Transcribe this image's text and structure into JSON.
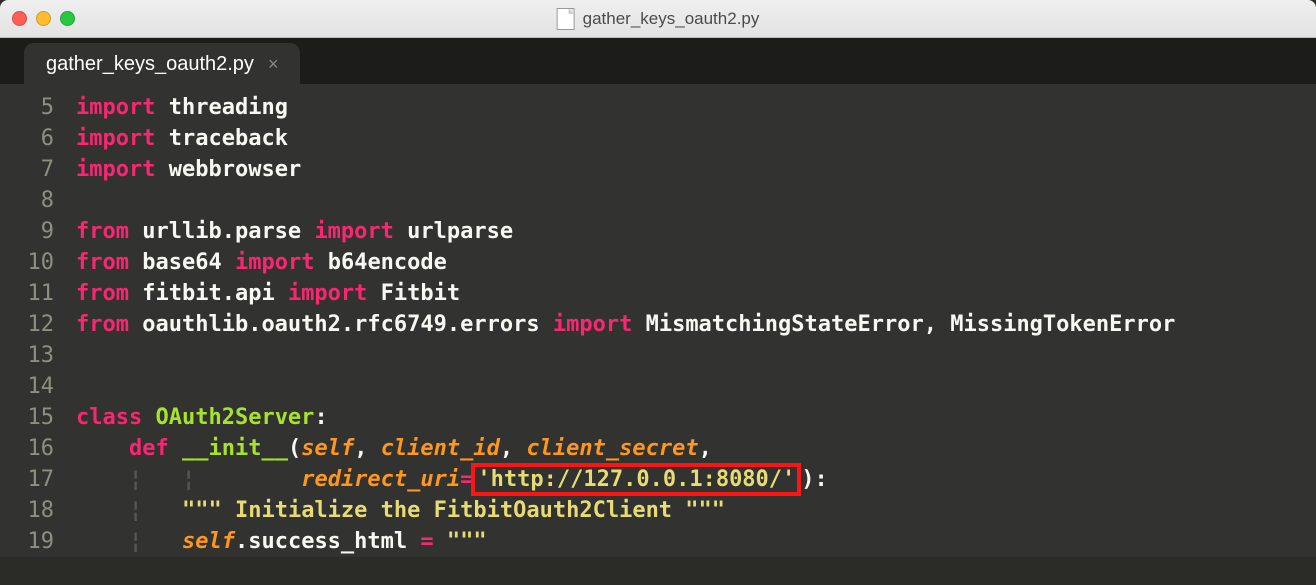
{
  "window": {
    "title": "gather_keys_oauth2.py"
  },
  "tab": {
    "filename": "gather_keys_oauth2.py"
  },
  "gutter_start": 5,
  "code": {
    "l5": {
      "kw": "import",
      "mod": "threading"
    },
    "l6": {
      "kw": "import",
      "mod": "traceback"
    },
    "l7": {
      "kw": "import",
      "mod": "webbrowser"
    },
    "l9": {
      "from": "from",
      "mod": "urllib.parse",
      "imp": "import",
      "name": "urlparse"
    },
    "l10": {
      "from": "from",
      "mod": "base64",
      "imp": "import",
      "name": "b64encode"
    },
    "l11": {
      "from": "from",
      "mod": "fitbit.api",
      "imp": "import",
      "name": "Fitbit"
    },
    "l12": {
      "from": "from",
      "mod": "oauthlib.oauth2.rfc6749.errors",
      "imp": "import",
      "name": "MismatchingStateError, MissingTokenError"
    },
    "l15": {
      "kw": "class",
      "name": "OAuth2Server",
      "suffix": ":"
    },
    "l16": {
      "kw": "def",
      "name": "__init__",
      "sig_a": "(",
      "self": "self",
      "comma": ", ",
      "p1": "client_id",
      "p2": "client_secret",
      "tail": ","
    },
    "l17": {
      "kwarg": "redirect_uri",
      "eq": "=",
      "val": "'http://127.0.0.1:8080/'",
      "tail": ":"
    },
    "l18": {
      "doc": "\"\"\" Initialize the FitbitOauth2Client \"\"\""
    },
    "l19": {
      "self": "self",
      "attr": ".success_html ",
      "eq": "=",
      "val": " \"\"\""
    }
  }
}
